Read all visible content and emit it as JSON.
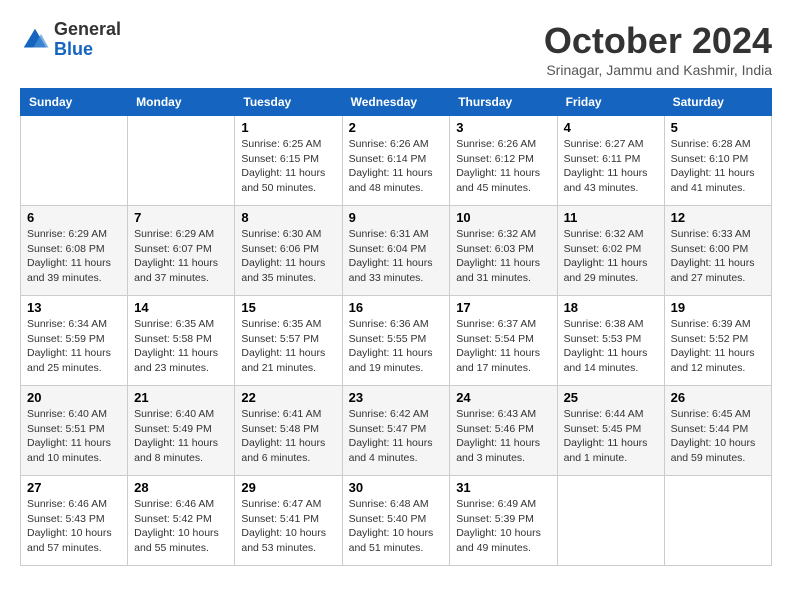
{
  "logo": {
    "line1": "General",
    "line2": "Blue"
  },
  "title": "October 2024",
  "location": "Srinagar, Jammu and Kashmir, India",
  "days_header": [
    "Sunday",
    "Monday",
    "Tuesday",
    "Wednesday",
    "Thursday",
    "Friday",
    "Saturday"
  ],
  "weeks": [
    [
      {
        "day": "",
        "info": ""
      },
      {
        "day": "",
        "info": ""
      },
      {
        "day": "1",
        "info": "Sunrise: 6:25 AM\nSunset: 6:15 PM\nDaylight: 11 hours and 50 minutes."
      },
      {
        "day": "2",
        "info": "Sunrise: 6:26 AM\nSunset: 6:14 PM\nDaylight: 11 hours and 48 minutes."
      },
      {
        "day": "3",
        "info": "Sunrise: 6:26 AM\nSunset: 6:12 PM\nDaylight: 11 hours and 45 minutes."
      },
      {
        "day": "4",
        "info": "Sunrise: 6:27 AM\nSunset: 6:11 PM\nDaylight: 11 hours and 43 minutes."
      },
      {
        "day": "5",
        "info": "Sunrise: 6:28 AM\nSunset: 6:10 PM\nDaylight: 11 hours and 41 minutes."
      }
    ],
    [
      {
        "day": "6",
        "info": "Sunrise: 6:29 AM\nSunset: 6:08 PM\nDaylight: 11 hours and 39 minutes."
      },
      {
        "day": "7",
        "info": "Sunrise: 6:29 AM\nSunset: 6:07 PM\nDaylight: 11 hours and 37 minutes."
      },
      {
        "day": "8",
        "info": "Sunrise: 6:30 AM\nSunset: 6:06 PM\nDaylight: 11 hours and 35 minutes."
      },
      {
        "day": "9",
        "info": "Sunrise: 6:31 AM\nSunset: 6:04 PM\nDaylight: 11 hours and 33 minutes."
      },
      {
        "day": "10",
        "info": "Sunrise: 6:32 AM\nSunset: 6:03 PM\nDaylight: 11 hours and 31 minutes."
      },
      {
        "day": "11",
        "info": "Sunrise: 6:32 AM\nSunset: 6:02 PM\nDaylight: 11 hours and 29 minutes."
      },
      {
        "day": "12",
        "info": "Sunrise: 6:33 AM\nSunset: 6:00 PM\nDaylight: 11 hours and 27 minutes."
      }
    ],
    [
      {
        "day": "13",
        "info": "Sunrise: 6:34 AM\nSunset: 5:59 PM\nDaylight: 11 hours and 25 minutes."
      },
      {
        "day": "14",
        "info": "Sunrise: 6:35 AM\nSunset: 5:58 PM\nDaylight: 11 hours and 23 minutes."
      },
      {
        "day": "15",
        "info": "Sunrise: 6:35 AM\nSunset: 5:57 PM\nDaylight: 11 hours and 21 minutes."
      },
      {
        "day": "16",
        "info": "Sunrise: 6:36 AM\nSunset: 5:55 PM\nDaylight: 11 hours and 19 minutes."
      },
      {
        "day": "17",
        "info": "Sunrise: 6:37 AM\nSunset: 5:54 PM\nDaylight: 11 hours and 17 minutes."
      },
      {
        "day": "18",
        "info": "Sunrise: 6:38 AM\nSunset: 5:53 PM\nDaylight: 11 hours and 14 minutes."
      },
      {
        "day": "19",
        "info": "Sunrise: 6:39 AM\nSunset: 5:52 PM\nDaylight: 11 hours and 12 minutes."
      }
    ],
    [
      {
        "day": "20",
        "info": "Sunrise: 6:40 AM\nSunset: 5:51 PM\nDaylight: 11 hours and 10 minutes."
      },
      {
        "day": "21",
        "info": "Sunrise: 6:40 AM\nSunset: 5:49 PM\nDaylight: 11 hours and 8 minutes."
      },
      {
        "day": "22",
        "info": "Sunrise: 6:41 AM\nSunset: 5:48 PM\nDaylight: 11 hours and 6 minutes."
      },
      {
        "day": "23",
        "info": "Sunrise: 6:42 AM\nSunset: 5:47 PM\nDaylight: 11 hours and 4 minutes."
      },
      {
        "day": "24",
        "info": "Sunrise: 6:43 AM\nSunset: 5:46 PM\nDaylight: 11 hours and 3 minutes."
      },
      {
        "day": "25",
        "info": "Sunrise: 6:44 AM\nSunset: 5:45 PM\nDaylight: 11 hours and 1 minute."
      },
      {
        "day": "26",
        "info": "Sunrise: 6:45 AM\nSunset: 5:44 PM\nDaylight: 10 hours and 59 minutes."
      }
    ],
    [
      {
        "day": "27",
        "info": "Sunrise: 6:46 AM\nSunset: 5:43 PM\nDaylight: 10 hours and 57 minutes."
      },
      {
        "day": "28",
        "info": "Sunrise: 6:46 AM\nSunset: 5:42 PM\nDaylight: 10 hours and 55 minutes."
      },
      {
        "day": "29",
        "info": "Sunrise: 6:47 AM\nSunset: 5:41 PM\nDaylight: 10 hours and 53 minutes."
      },
      {
        "day": "30",
        "info": "Sunrise: 6:48 AM\nSunset: 5:40 PM\nDaylight: 10 hours and 51 minutes."
      },
      {
        "day": "31",
        "info": "Sunrise: 6:49 AM\nSunset: 5:39 PM\nDaylight: 10 hours and 49 minutes."
      },
      {
        "day": "",
        "info": ""
      },
      {
        "day": "",
        "info": ""
      }
    ]
  ]
}
